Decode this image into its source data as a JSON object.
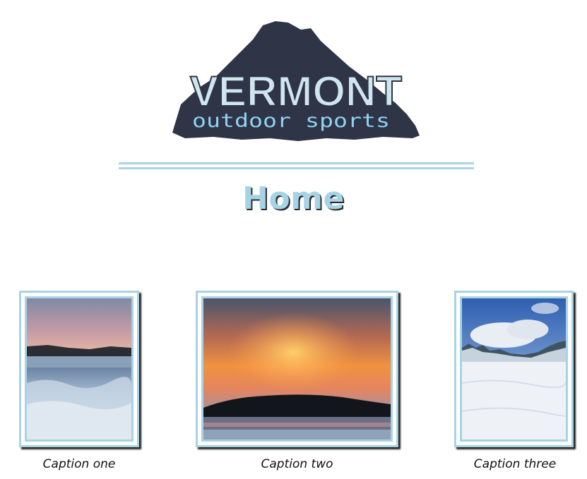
{
  "logo": {
    "wordmark": "VERMONT",
    "tagline": "outdoor sports",
    "colors": {
      "mountain": "#2f3447",
      "text_fill": "#cfe6ef",
      "tagline": "#8fd3f0"
    }
  },
  "page": {
    "title": "Home"
  },
  "gallery": [
    {
      "caption": "Caption one"
    },
    {
      "caption": "Caption two"
    },
    {
      "caption": "Caption three"
    }
  ],
  "colors": {
    "accent": "#a9d3e3",
    "title": "#a7d3e6"
  }
}
